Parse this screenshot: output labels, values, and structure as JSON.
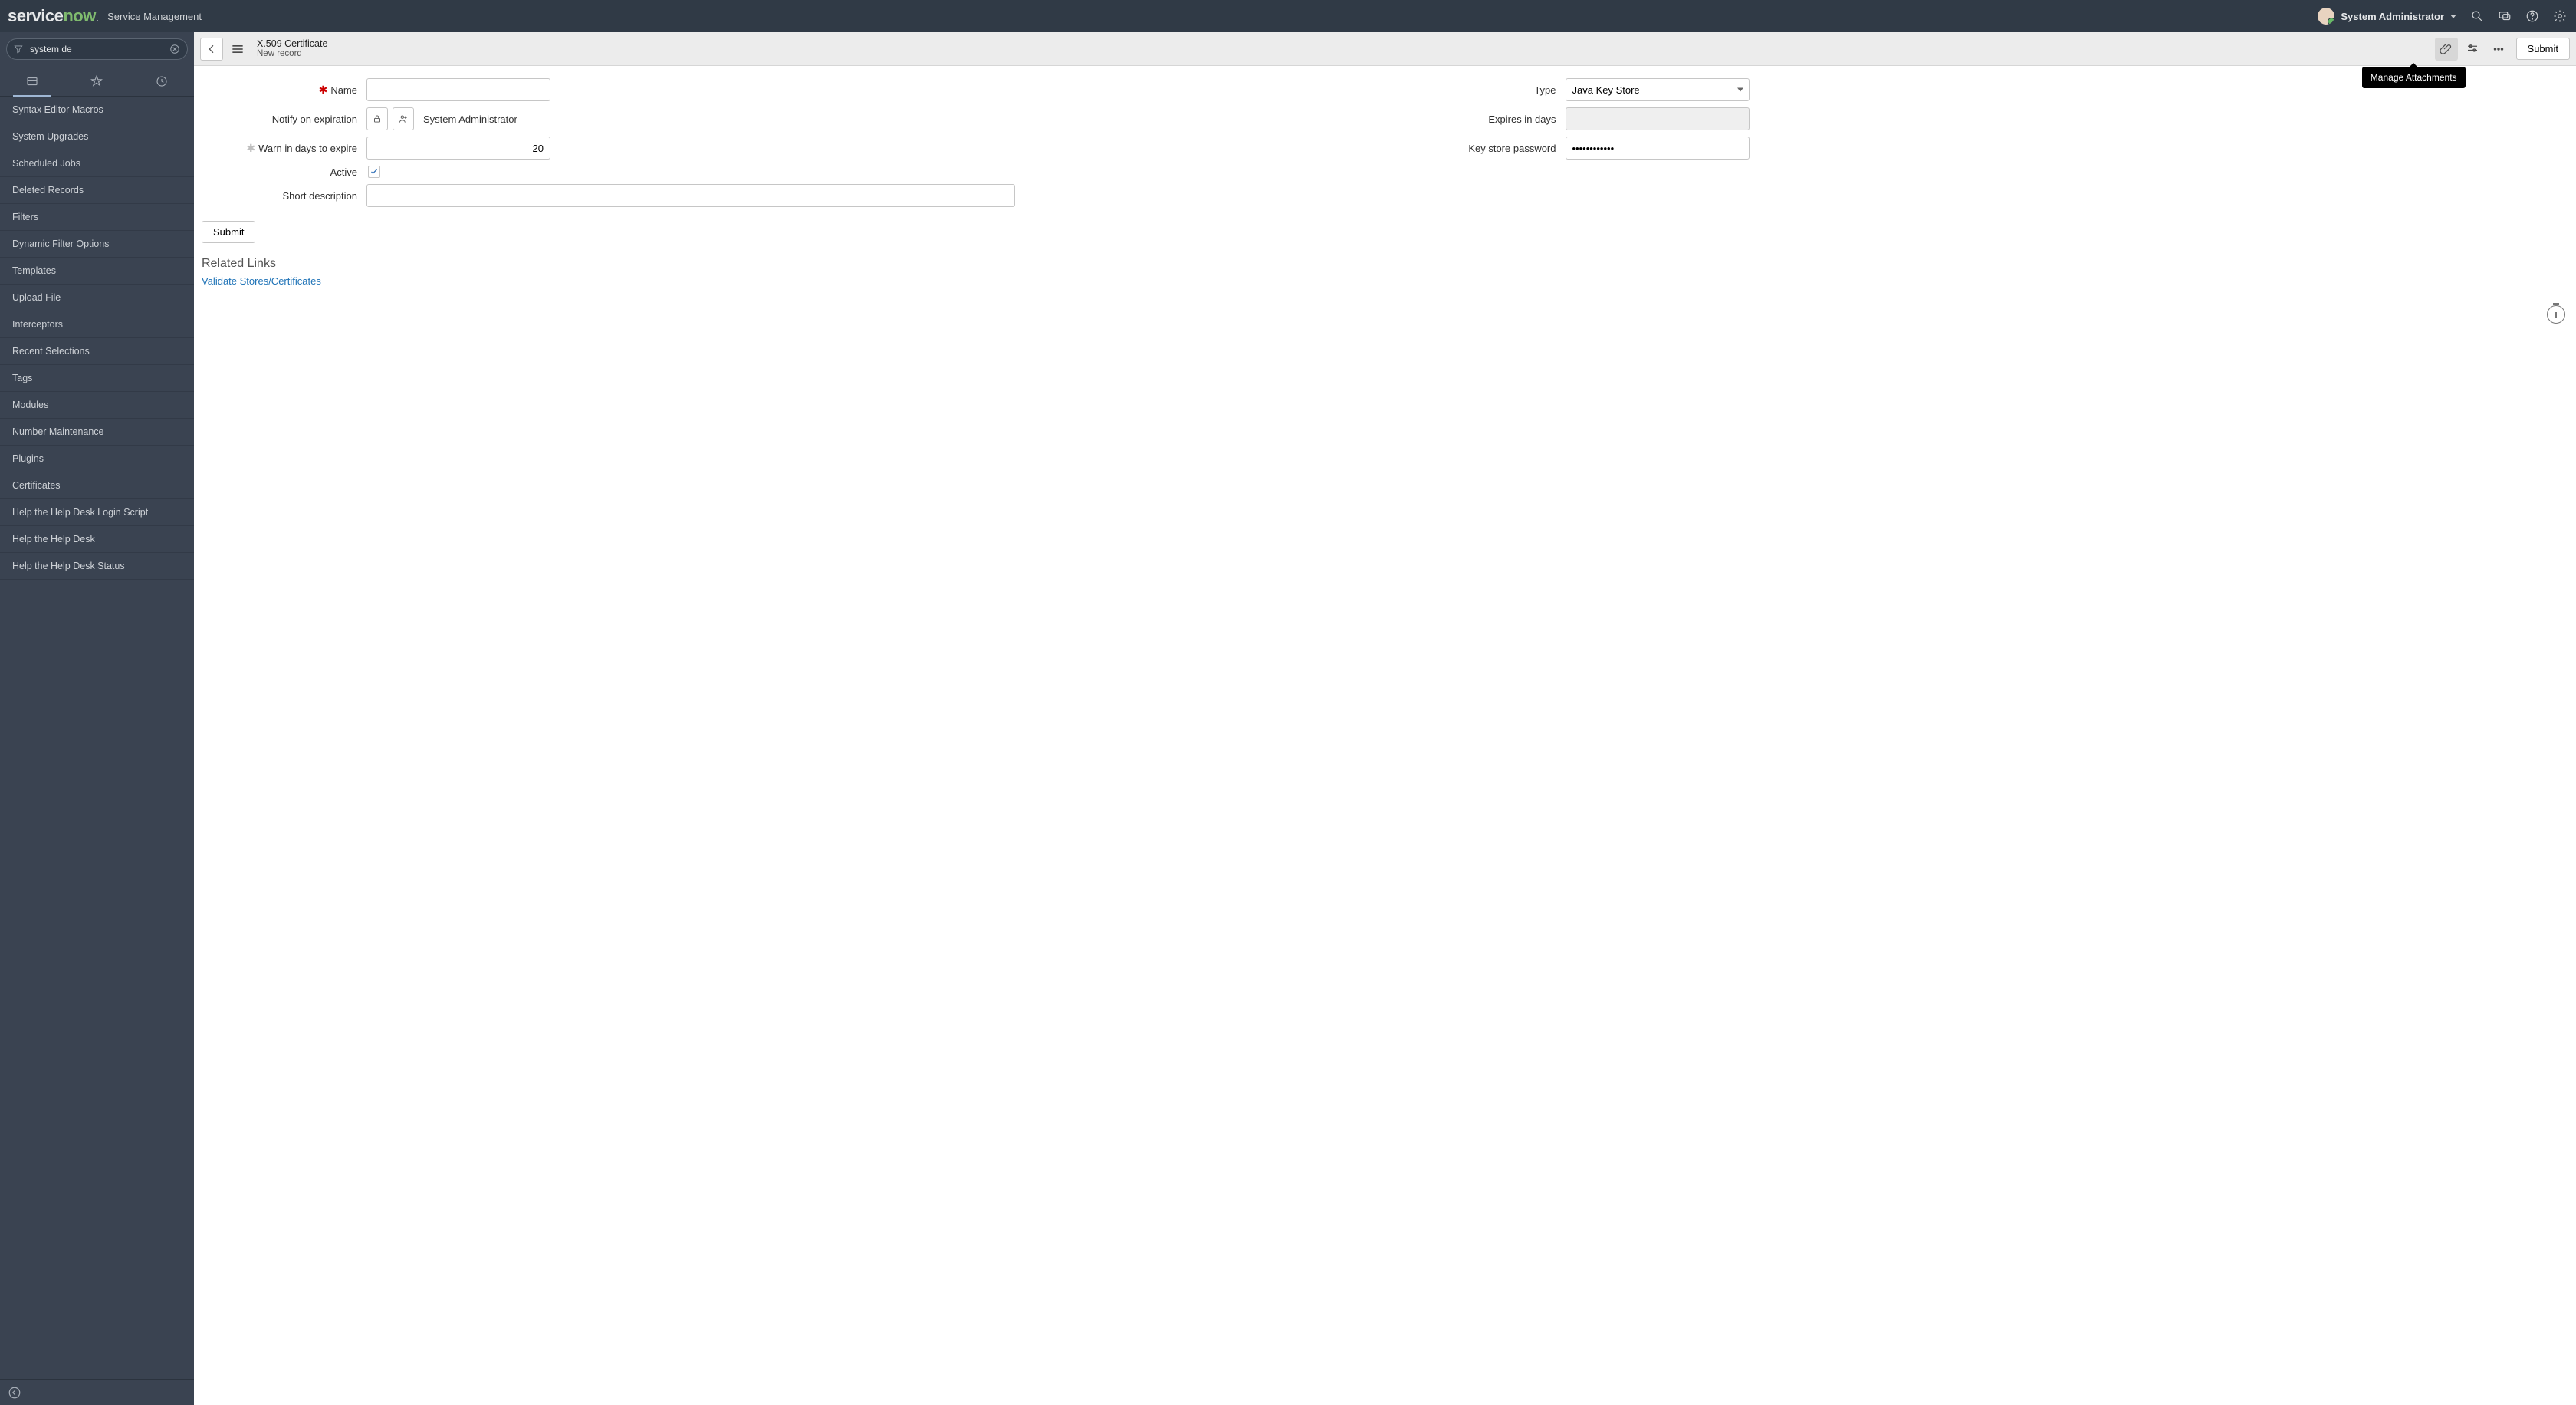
{
  "brand": {
    "logo1": "service",
    "logo2": "now",
    "title": "Service Management"
  },
  "user": {
    "name": "System Administrator"
  },
  "sidebar": {
    "filter_value": "system de",
    "items": [
      {
        "label": "Syntax Editor Macros"
      },
      {
        "label": "System Upgrades"
      },
      {
        "label": "Scheduled Jobs"
      },
      {
        "label": "Deleted Records"
      },
      {
        "label": "Filters"
      },
      {
        "label": "Dynamic Filter Options"
      },
      {
        "label": "Templates"
      },
      {
        "label": "Upload File"
      },
      {
        "label": "Interceptors"
      },
      {
        "label": "Recent Selections"
      },
      {
        "label": "Tags"
      },
      {
        "label": "Modules"
      },
      {
        "label": "Number Maintenance"
      },
      {
        "label": "Plugins"
      },
      {
        "label": "Certificates"
      },
      {
        "label": "Help the Help Desk Login Script"
      },
      {
        "label": "Help the Help Desk"
      },
      {
        "label": "Help the Help Desk Status"
      }
    ]
  },
  "toolbar": {
    "title": "X.509 Certificate",
    "subtitle": "New record",
    "submit": "Submit",
    "tooltip": "Manage Attachments"
  },
  "form": {
    "name_label": "Name",
    "name_value": "",
    "type_label": "Type",
    "type_value": "Java Key Store",
    "notify_label": "Notify on expiration",
    "notify_value": "System Administrator",
    "expires_label": "Expires in days",
    "expires_value": "",
    "warn_label": "Warn in days to expire",
    "warn_value": "20",
    "password_label": "Key store password",
    "password_value": "••••••••••••",
    "active_label": "Active",
    "active_checked": true,
    "shortdesc_label": "Short description",
    "shortdesc_value": ""
  },
  "bottom": {
    "submit": "Submit",
    "section": "Related Links",
    "link": "Validate Stores/Certificates"
  }
}
